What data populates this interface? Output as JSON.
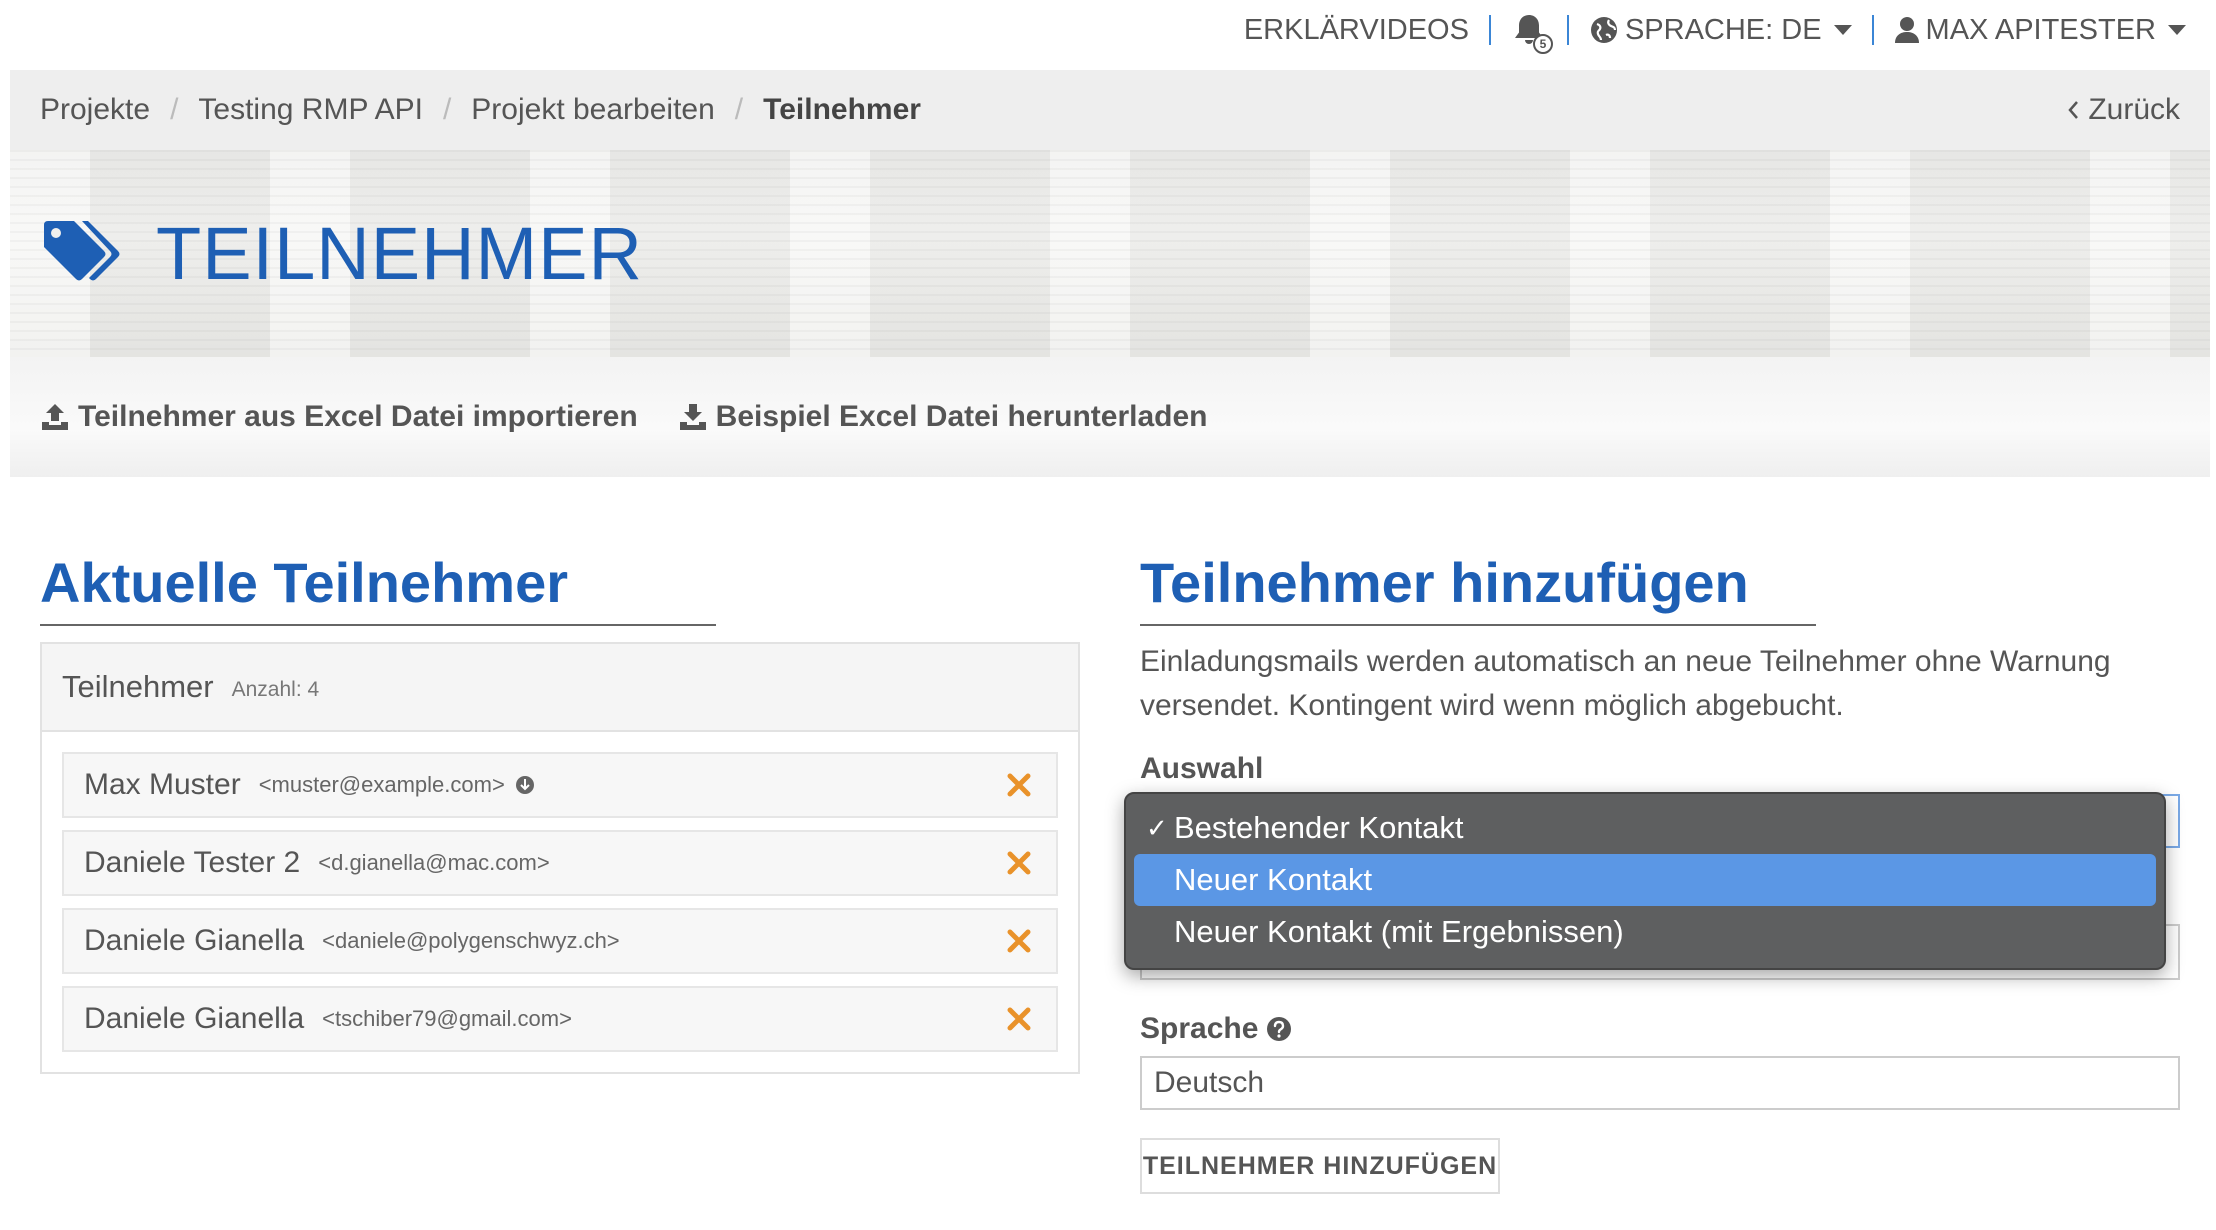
{
  "topbar": {
    "videos": "ERKLÄRVIDEOS",
    "notification_count": "5",
    "language": "SPRACHE: DE",
    "user": "MAX APITESTER"
  },
  "breadcrumb": {
    "items": [
      "Projekte",
      "Testing RMP API",
      "Projekt bearbeiten"
    ],
    "current": "Teilnehmer",
    "back": "Zurück"
  },
  "hero": {
    "title": "TEILNEHMER"
  },
  "actions": {
    "import": "Teilnehmer aus Excel Datei importieren",
    "download": "Beispiel Excel Datei herunterladen"
  },
  "current": {
    "title": "Aktuelle Teilnehmer",
    "panel_title": "Teilnehmer",
    "count_label": "Anzahl: 4",
    "participants": [
      {
        "name": "Max Muster",
        "email": "<muster@example.com>"
      },
      {
        "name": "Daniele Tester 2",
        "email": "<d.gianella@mac.com>"
      },
      {
        "name": "Daniele Gianella",
        "email": "<daniele@polygenschwyz.ch>"
      },
      {
        "name": "Daniele Gianella",
        "email": "<tschiber79@gmail.com>"
      }
    ]
  },
  "add": {
    "title": "Teilnehmer hinzufügen",
    "description": "Einladungsmails werden automatisch an neue Teilnehmer ohne Warnung versendet. Kontingent wird wenn möglich abgebucht.",
    "auswahl_label": "Auswahl",
    "options": [
      "Bestehender Kontakt",
      "Neuer Kontakt",
      "Neuer Kontakt (mit Ergebnissen)"
    ],
    "checked_option": "Bestehender Kontakt",
    "highlighted_option": "Neuer Kontakt",
    "sprache_label": "Sprache",
    "sprache_value": "Deutsch",
    "submit": "TEILNEHMER HINZUFÜGEN"
  },
  "colors": {
    "brand_blue": "#1e5fb4",
    "accent_orange": "#e9922a",
    "dropdown_bg": "#5e5f60",
    "dropdown_highlight": "#5b97e5"
  }
}
